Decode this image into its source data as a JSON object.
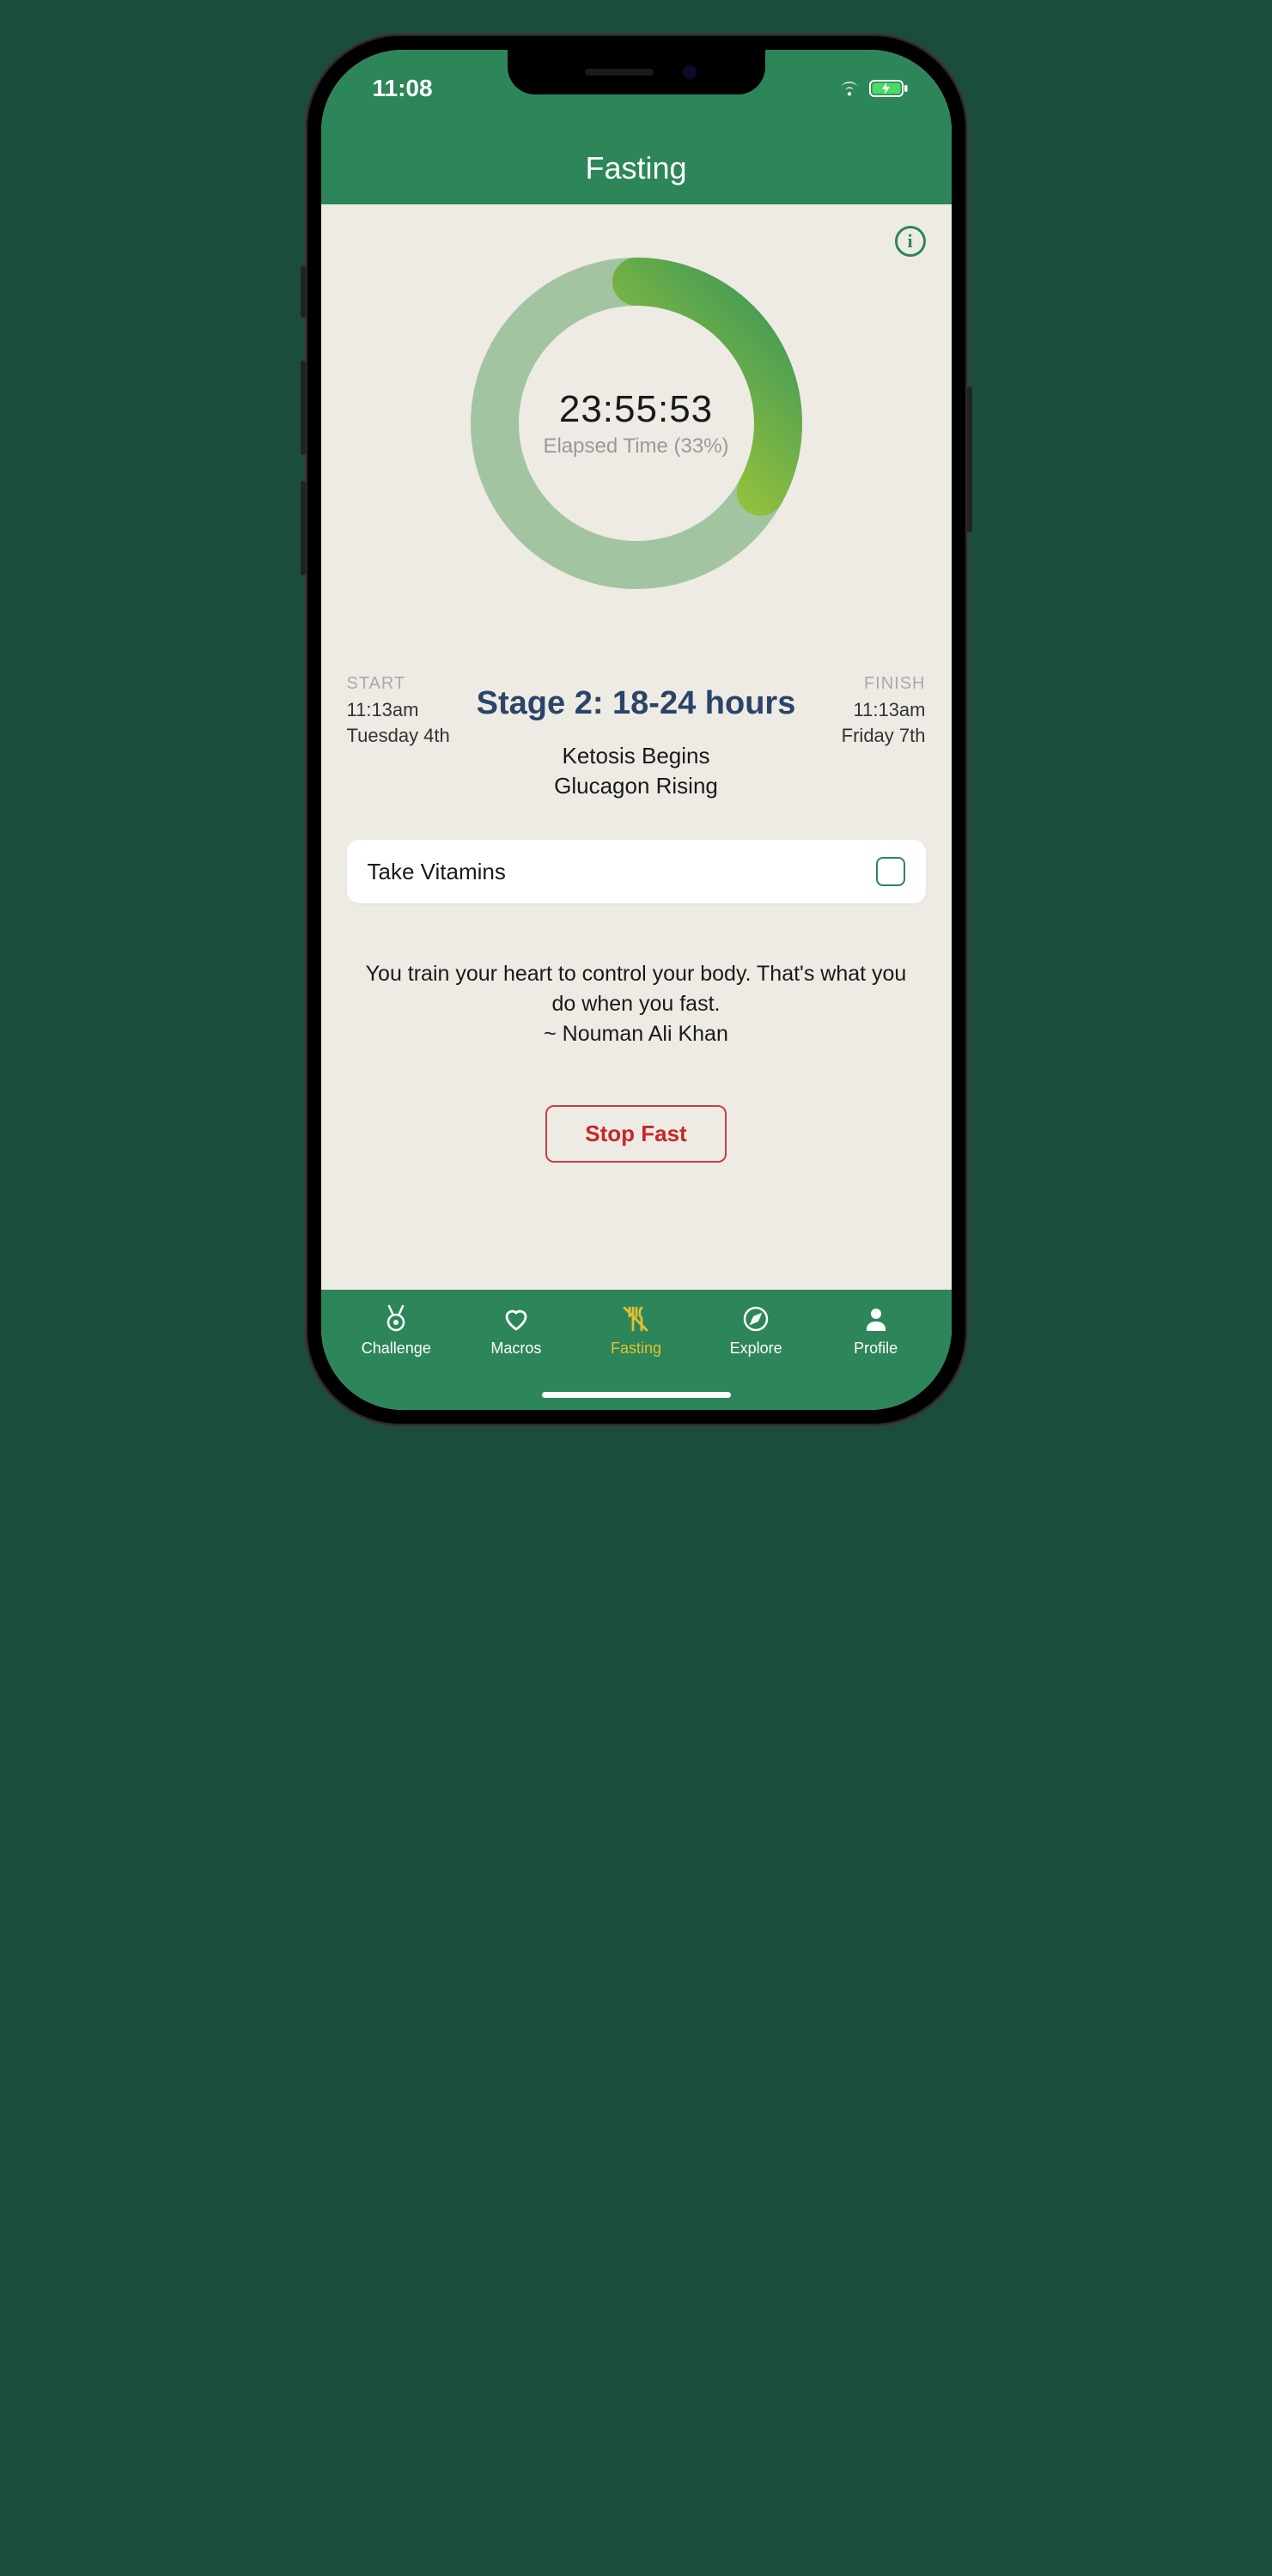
{
  "status": {
    "time": "11:08"
  },
  "header": {
    "title": "Fasting"
  },
  "timer": {
    "value": "23:55:53",
    "elapsed_label": "Elapsed Time (33%)"
  },
  "start": {
    "label": "START",
    "time": "11:13am",
    "day": "Tuesday 4th"
  },
  "finish": {
    "label": "FINISH",
    "time": "11:13am",
    "day": "Friday 7th"
  },
  "stage": {
    "title": "Stage 2: 18-24 hours",
    "line1": "Ketosis Begins",
    "line2": "Glucagon Rising"
  },
  "task": {
    "label": "Take Vitamins"
  },
  "quote": {
    "text": "You train your heart to control your body. That's what you do when you fast.",
    "author": "~ Nouman Ali Khan"
  },
  "buttons": {
    "stop": "Stop Fast"
  },
  "tabs": {
    "challenge": "Challenge",
    "macros": "Macros",
    "fasting": "Fasting",
    "explore": "Explore",
    "profile": "Profile"
  }
}
